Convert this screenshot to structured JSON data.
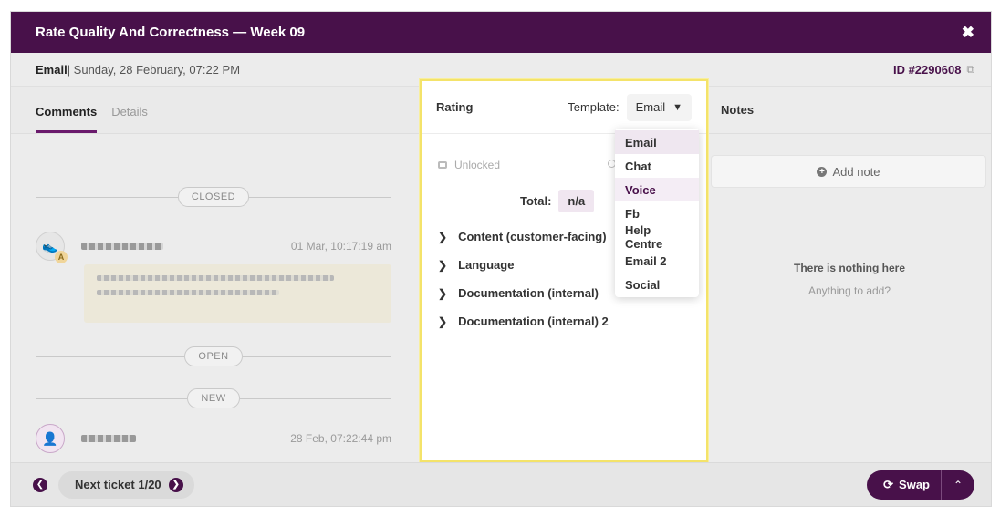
{
  "modal": {
    "title": "Rate Quality And Correctness — Week 09",
    "close_glyph": "✖"
  },
  "info": {
    "channel": "Email",
    "date": "| Sunday, 28 February, 07:22 PM",
    "ticket_id": "ID #2290608",
    "external_glyph": "⧉"
  },
  "comments": {
    "tabs": [
      {
        "label": "Comments"
      },
      {
        "label": "Details"
      }
    ],
    "dividers": {
      "closed": "CLOSED",
      "open": "OPEN",
      "new": "NEW"
    },
    "entries": [
      {
        "time": "01 Mar, 10:17:19 am",
        "badge": "A"
      },
      {
        "time": "28 Feb, 07:22:44 pm"
      }
    ]
  },
  "rating": {
    "label": "Rating",
    "template_label": "Template:",
    "template_value": "Email",
    "lock_status": "Unlocked",
    "total_label": "Total:",
    "total_value": "n/a",
    "sections": [
      {
        "label": "Content (customer-facing)"
      },
      {
        "label": "Language"
      },
      {
        "label": "Documentation (internal)"
      },
      {
        "label": "Documentation (internal) 2"
      }
    ],
    "template_options": [
      "Email",
      "Chat",
      "Voice",
      "Fb",
      "Help Centre",
      "Email 2",
      "Social"
    ]
  },
  "notes": {
    "title": "Notes",
    "add_label": "Add note",
    "empty_title": "There is nothing here",
    "empty_sub": "Anything to add?"
  },
  "footer": {
    "next_label": "Next ticket 1/20",
    "swap_label": "Swap",
    "prev_glyph": "❮",
    "next_glyph": "❯",
    "up_glyph": "⌃"
  },
  "colors": {
    "brand": "#48114a",
    "highlight": "#f4e36a"
  }
}
